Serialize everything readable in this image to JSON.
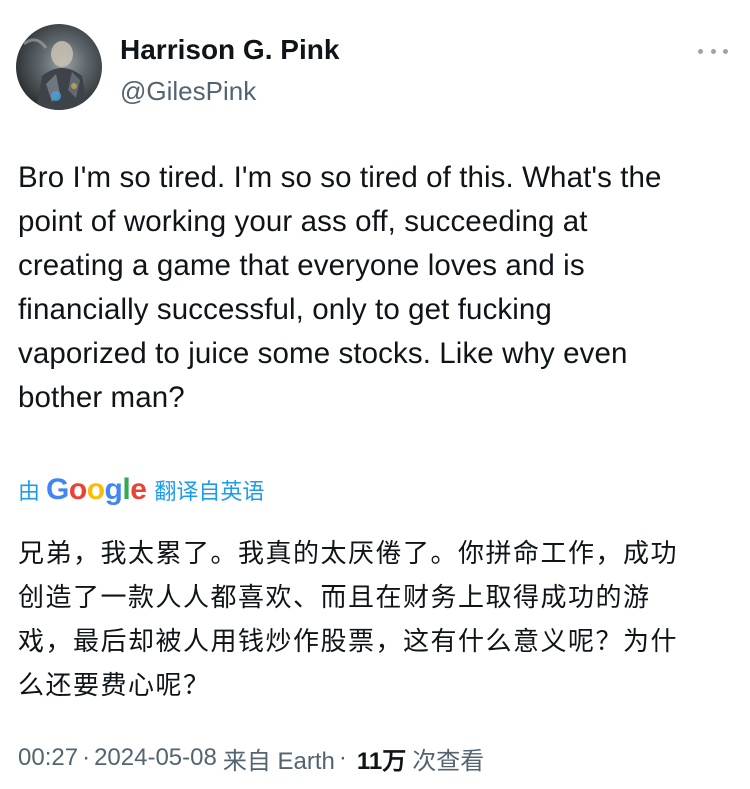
{
  "author": {
    "name": "Harrison G. Pink",
    "handle": "@GilesPink"
  },
  "tweet": {
    "text": "Bro I'm so tired. I'm so so tired of this. What's the\npoint of working your ass off, succeeding at\ncreating a game that everyone loves and is\nfinancially successful, only to get fucking\nvaporized to juice some stocks. Like why even\nbother man?"
  },
  "translation": {
    "by": "由",
    "provider": {
      "letters": [
        "G",
        "o",
        "o",
        "g",
        "l",
        "e"
      ],
      "colors": [
        "#4285F4",
        "#EA4335",
        "#FBBC05",
        "#4285F4",
        "#34A853",
        "#EA4335"
      ]
    },
    "from": "翻译自英语",
    "text": "兄弟，我太累了。我真的太厌倦了。你拼命工作，成功\n创造了一款人人都喜欢、而且在财务上取得成功的游\n戏，最后却被人用钱炒作股票，这有什么意义呢？为什\n么还要费心呢？"
  },
  "meta": {
    "time": "00:27",
    "separator": "·",
    "date": "2024-05-08",
    "source": "来自 Earth",
    "views_count": "11万",
    "views_label": "次查看"
  },
  "icons": {
    "more": "more-horizontal-icon"
  },
  "colors": {
    "link": "#1d9bf0",
    "secondary_text": "#536471",
    "primary_text": "#0f1419"
  }
}
